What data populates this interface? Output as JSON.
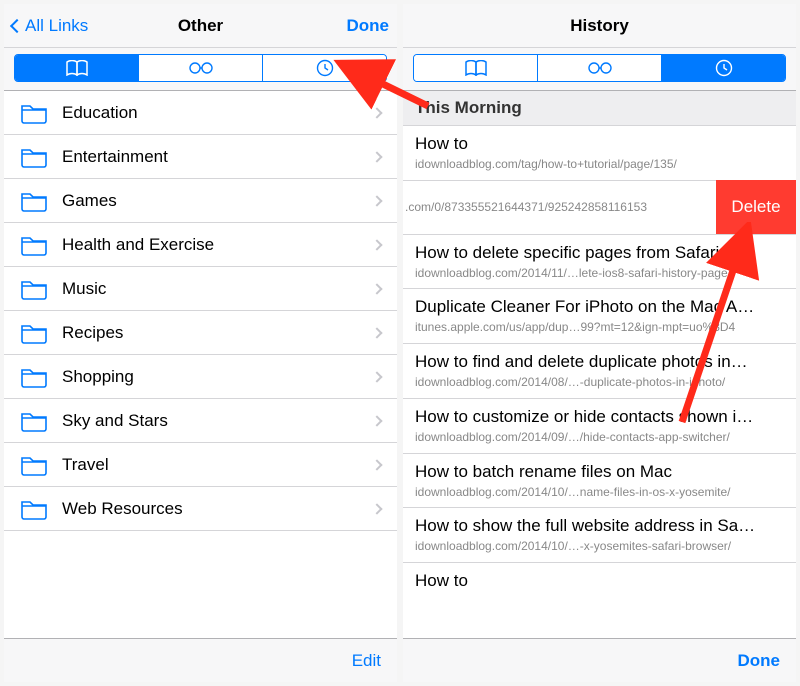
{
  "left": {
    "back_label": "All Links",
    "title": "Other",
    "done_label": "Done",
    "folders": [
      "Education",
      "Entertainment",
      "Games",
      "Health and Exercise",
      "Music",
      "Recipes",
      "Shopping",
      "Sky and Stars",
      "Travel",
      "Web Resources"
    ],
    "toolbar_edit": "Edit"
  },
  "right": {
    "title": "History",
    "section_header": "This Morning",
    "swiped_url_fragment": ".com/0/873355521644371/925242858116153",
    "delete_label": "Delete",
    "items": [
      {
        "title": "How to",
        "url": "idownloadblog.com/tag/how-to+tutorial/page/135/"
      },
      {
        "title": "How to delete specific pages from Safari hi…",
        "url": "idownloadblog.com/2014/11/…lete-ios8-safari-history-page/"
      },
      {
        "title": "Duplicate Cleaner For iPhoto on the Mac A…",
        "url": "itunes.apple.com/us/app/dup…99?mt=12&ign-mpt=uo%3D4"
      },
      {
        "title": "How to find and delete duplicate photos in…",
        "url": "idownloadblog.com/2014/08/…-duplicate-photos-in-iphoto/"
      },
      {
        "title": "How to customize or hide contacts shown i…",
        "url": "idownloadblog.com/2014/09/…/hide-contacts-app-switcher/"
      },
      {
        "title": "How to batch rename files on Mac",
        "url": "idownloadblog.com/2014/10/…name-files-in-os-x-yosemite/"
      },
      {
        "title": "How to show the full website address in Sa…",
        "url": "idownloadblog.com/2014/10/…-x-yosemites-safari-browser/"
      },
      {
        "title": "How to",
        "url": ""
      }
    ],
    "toolbar_done": "Done"
  },
  "colors": {
    "tint": "#007aff",
    "delete": "#ff3b30",
    "arrow": "#ff2a1a"
  }
}
